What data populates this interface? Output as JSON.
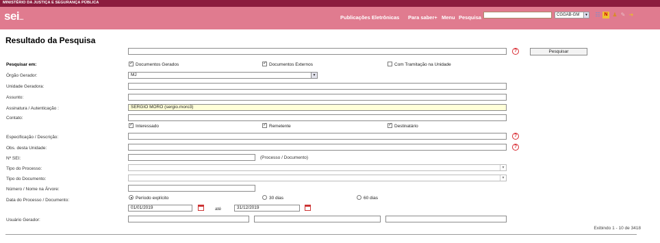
{
  "topbar": {
    "ministry": "MINISTÉRIO DA JUSTIÇA E SEGURANÇA PÚBLICA"
  },
  "header": {
    "logo": "sei",
    "logo_suffix": "...",
    "nav": [
      "Publicações Eletrônicas",
      "Para saber+",
      "Menu",
      "Pesquisa"
    ],
    "search_value": "",
    "unit": "CGGAB-GM",
    "icons": [
      "grid-icon",
      "news-icon",
      "user-icon",
      "wrench-icon",
      "exit-icon"
    ]
  },
  "page": {
    "title": "Resultado da Pesquisa"
  },
  "search": {
    "query": "",
    "button": "Pesquisar"
  },
  "labels": {
    "pesquisar_em": "Pesquisar em:",
    "orgao": "Órgão Gerador:",
    "unidade": "Unidade Geradora:",
    "assunto": "Assunto:",
    "assinatura": "Assinatura / Autenticação :",
    "contato": "Contato:",
    "especificacao": "Especificação / Descrição:",
    "obs": "Obs. desta Unidade:",
    "nsei": "Nº SEI:",
    "tipo_processo": "Tipo do Processo:",
    "tipo_documento": "Tipo do Documento:",
    "numero_arvore": "Número / Nome na Árvore:",
    "data": "Data do Processo / Documento:",
    "usuario": "Usuário Gerador:"
  },
  "pesquisar_em": [
    {
      "label": "Documentos Gerados",
      "checked": true
    },
    {
      "label": "Documentos Externos",
      "checked": true
    },
    {
      "label": "Com Tramitação na Unidade",
      "checked": false
    }
  ],
  "orgao": {
    "value": "MJ"
  },
  "assinatura": {
    "value": "SERGIO MORO (sergio.moro3)"
  },
  "contato_options": [
    {
      "label": "Interessado",
      "checked": true
    },
    {
      "label": "Remetente",
      "checked": true
    },
    {
      "label": "Destinatário",
      "checked": true
    }
  ],
  "nsei": {
    "hint": "(Processo / Documento)"
  },
  "periodo": [
    {
      "label": "Período explícito",
      "selected": true
    },
    {
      "label": "30 dias",
      "selected": false
    },
    {
      "label": "60 dias",
      "selected": false
    }
  ],
  "datas": {
    "inicio": "01/01/2019",
    "separator": "até",
    "fim": "31/12/2019"
  },
  "results": {
    "summary": "Exibindo 1 - 10 de 3418"
  }
}
